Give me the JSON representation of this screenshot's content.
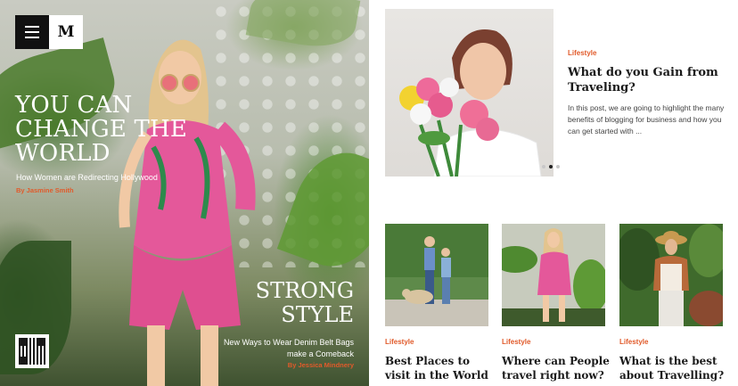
{
  "header": {
    "logo_letter": "M"
  },
  "hero": {
    "title": "You can change the world",
    "subtitle": "How Women are Redirecting Hollywood",
    "author": "By Jasmine Smith"
  },
  "hero_secondary": {
    "title": "Strong Style",
    "subtitle": "New Ways to Wear Denim Belt Bags make a Comeback",
    "author": "By Jessica Mindnery"
  },
  "featured": {
    "category": "Lifestyle",
    "title": "What do you Gain from Traveling?",
    "excerpt": "In this post, we are going to highlight the many benefits of blogging for business and how you can get started with ...",
    "slide_count": 3,
    "active_slide": 2
  },
  "cards": [
    {
      "category": "Lifestyle",
      "title": "Best Places to visit in the World"
    },
    {
      "category": "Lifestyle",
      "title": "Where can People travel right now?"
    },
    {
      "category": "Lifestyle",
      "title": "What is the best about Travelling?"
    }
  ],
  "colors": {
    "accent": "#e15a2a",
    "dark": "#111111"
  }
}
